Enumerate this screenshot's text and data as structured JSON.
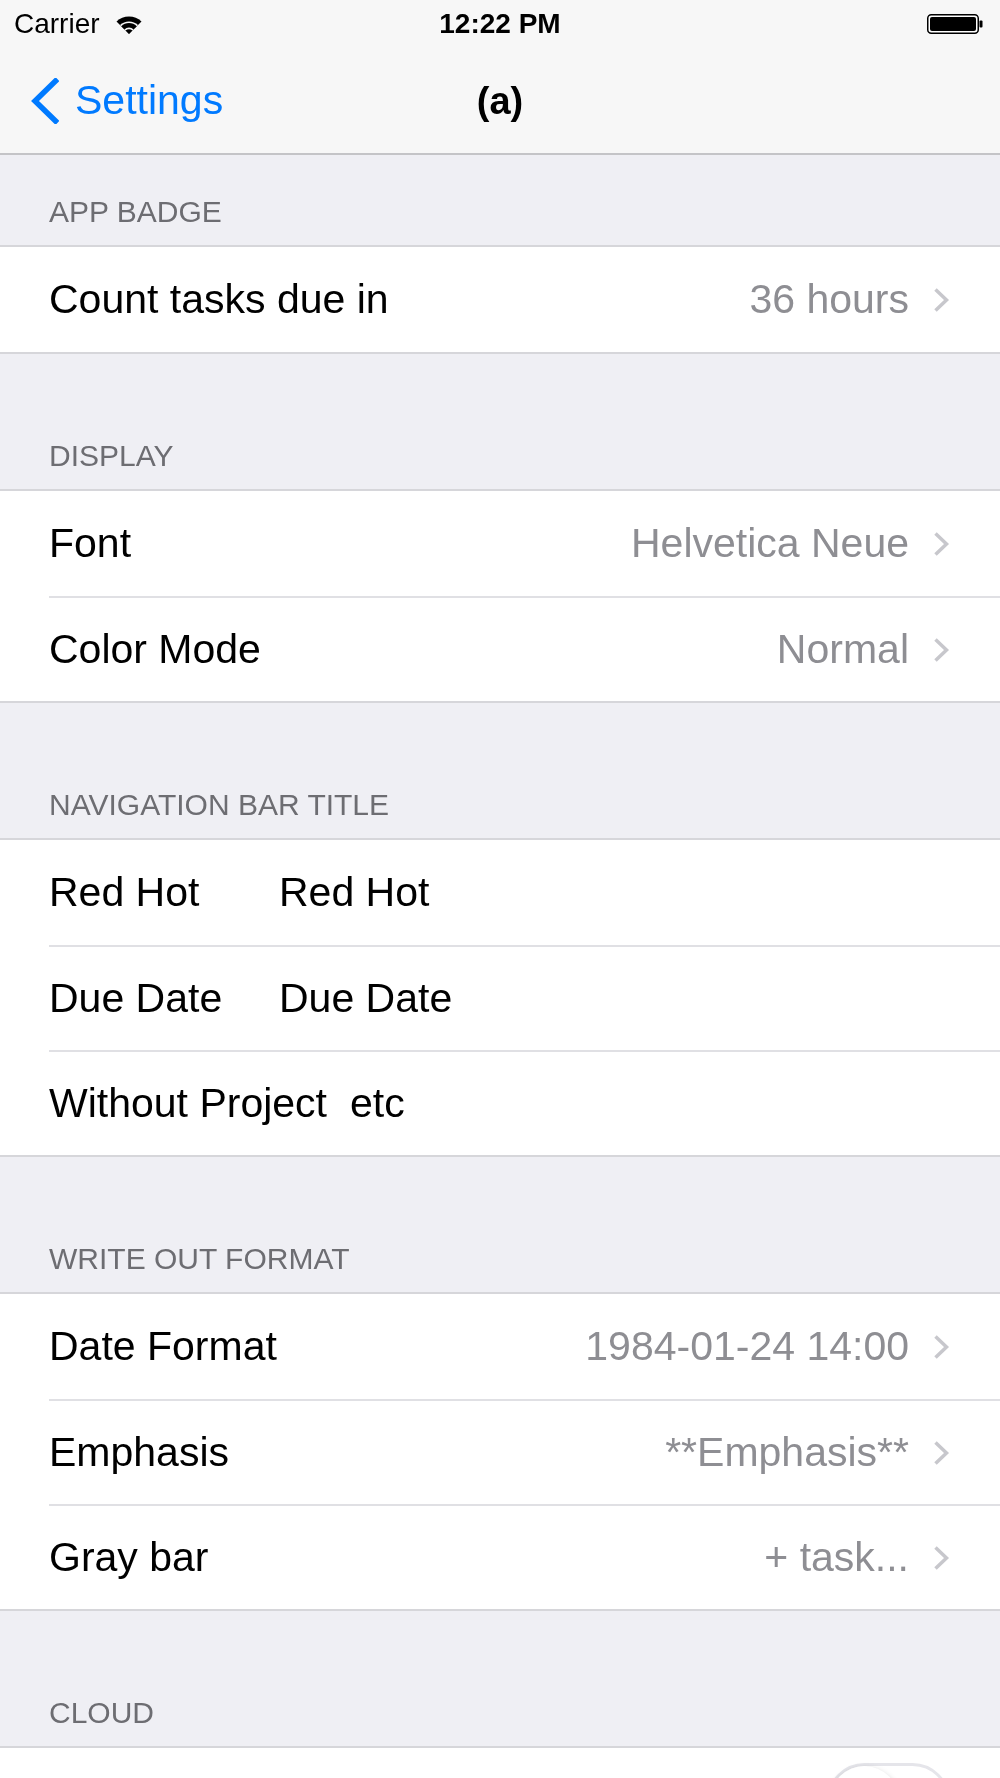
{
  "status_bar": {
    "carrier": "Carrier",
    "time": "12:22 PM"
  },
  "nav_bar": {
    "back_label": "Settings",
    "title": "(a)"
  },
  "sections": [
    {
      "header": "APP BADGE",
      "rows": [
        {
          "kind": "disclosure",
          "label": "Count tasks due in",
          "value": "36 hours"
        }
      ]
    },
    {
      "header": "DISPLAY",
      "rows": [
        {
          "kind": "disclosure",
          "label": "Font",
          "value": "Helvetica Neue"
        },
        {
          "kind": "disclosure",
          "label": "Color Mode",
          "value": "Normal"
        }
      ]
    },
    {
      "header": "NAVIGATION BAR TITLE",
      "rows": [
        {
          "kind": "pair",
          "label": "Red Hot",
          "value": "Red Hot"
        },
        {
          "kind": "pair",
          "label": "Due Date",
          "value": "Due Date"
        },
        {
          "kind": "pair",
          "label": "Without Project",
          "value": "etc"
        }
      ]
    },
    {
      "header": "WRITE OUT FORMAT",
      "rows": [
        {
          "kind": "disclosure",
          "label": "Date Format",
          "value": "1984-01-24 14:00"
        },
        {
          "kind": "disclosure",
          "label": "Emphasis",
          "value": "**Emphasis**"
        },
        {
          "kind": "disclosure",
          "label": "Gray bar",
          "value": "+ task..."
        }
      ]
    },
    {
      "header": "CLOUD",
      "rows": [
        {
          "kind": "toggle",
          "on": false
        }
      ]
    }
  ]
}
